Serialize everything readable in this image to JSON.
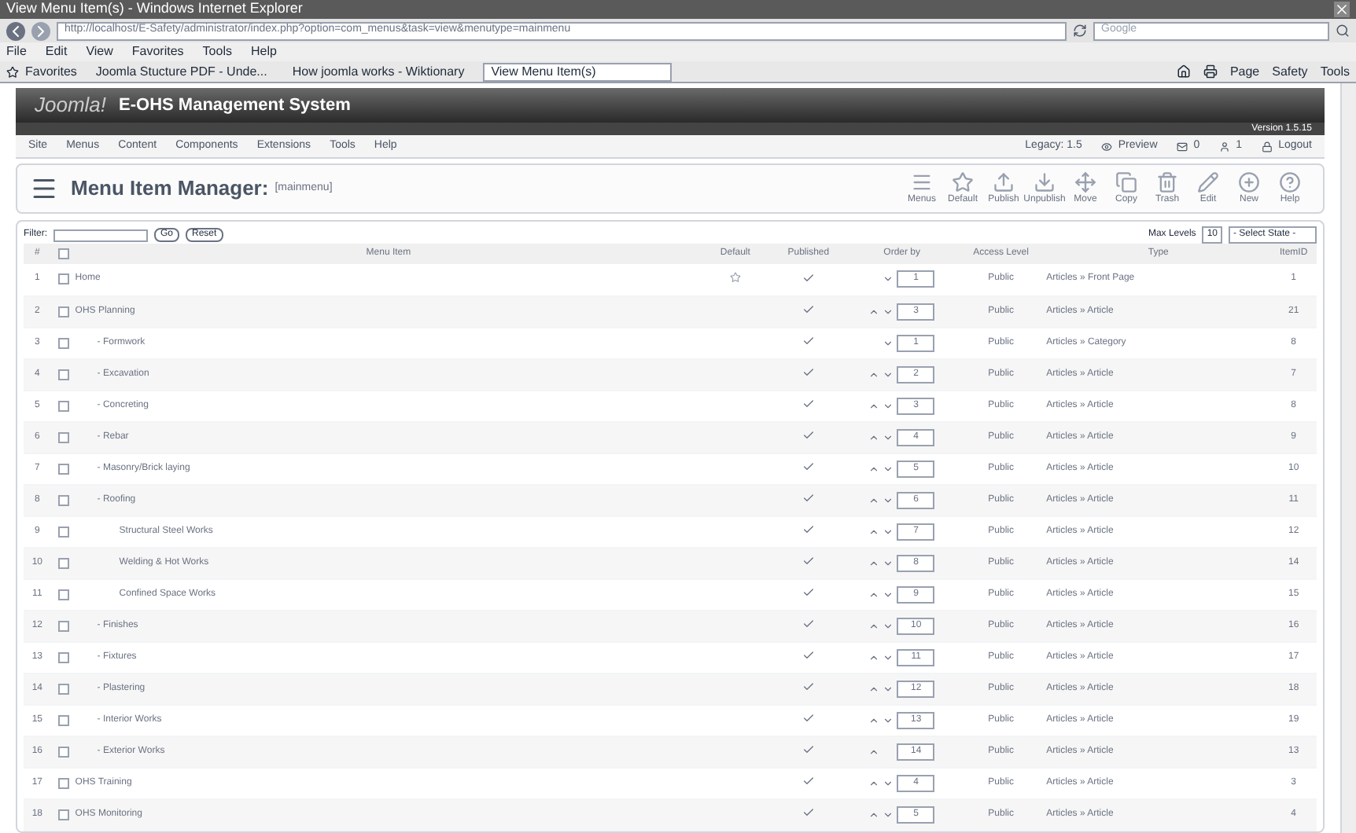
{
  "window": {
    "title": "View Menu Item(s) - Windows Internet Explorer"
  },
  "address_bar": {
    "url": "http://localhost/E-Safety/administrator/index.php?option=com_menus&task=view&menutype=mainmenu",
    "search_placeholder": "Google"
  },
  "browser_menu": [
    "File",
    "Edit",
    "View",
    "Favorites",
    "Tools",
    "Help"
  ],
  "favorites_bar": {
    "label": "Favorites",
    "tabs": [
      {
        "label": "Joomla Stucture PDF - Unde...",
        "selected": false
      },
      {
        "label": "How joomla works - Wiktionary",
        "selected": false
      },
      {
        "label": "View Menu Item(s)",
        "selected": true
      }
    ],
    "commands": [
      "Page",
      "Safety",
      "Tools"
    ]
  },
  "header": {
    "logo": "Joomla!",
    "title": "E-OHS Management System",
    "version": "Version 1.5.15"
  },
  "admin_menu": [
    "Site",
    "Menus",
    "Content",
    "Components",
    "Extensions",
    "Tools",
    "Help"
  ],
  "status": {
    "legacy": "Legacy: 1.5",
    "preview": "Preview",
    "messages": "0",
    "users": "1",
    "logout": "Logout"
  },
  "page_title": {
    "title": "Menu Item Manager:",
    "subtitle": "[mainmenu]"
  },
  "toolbar": [
    "Menus",
    "Default",
    "Publish",
    "Unpublish",
    "Move",
    "Copy",
    "Trash",
    "Edit",
    "New",
    "Help"
  ],
  "filter": {
    "label": "Filter:",
    "go": "Go",
    "reset": "Reset",
    "max_levels_label": "Max Levels",
    "max_levels": "10",
    "state": "- Select State -"
  },
  "table": {
    "columns": [
      "#",
      "Menu Item",
      "Default",
      "Published",
      "Order by",
      "Access Level",
      "Type",
      "ItemID"
    ],
    "select_all_checked": false,
    "rows": [
      {
        "num": "1",
        "title": "Home",
        "checked": false,
        "default": true,
        "published": true,
        "up": false,
        "down": true,
        "order": "1",
        "access": "Public",
        "type": "Articles » Front Page",
        "itemid": "1"
      },
      {
        "num": "2",
        "title": "OHS Planning",
        "checked": false,
        "default": false,
        "published": true,
        "up": true,
        "down": true,
        "order": "3",
        "access": "Public",
        "type": "Articles » Article",
        "itemid": "21",
        "children": [
          {
            "num": "3",
            "title": "- Formwork",
            "checked": false,
            "default": false,
            "published": true,
            "up": false,
            "down": true,
            "order": "1",
            "access": "Public",
            "type": "Articles » Category",
            "itemid": "8"
          },
          {
            "num": "4",
            "title": "- Excavation",
            "checked": false,
            "default": false,
            "published": true,
            "up": true,
            "down": true,
            "order": "2",
            "access": "Public",
            "type": "Articles » Article",
            "itemid": "7"
          },
          {
            "num": "5",
            "title": "- Concreting",
            "checked": false,
            "default": false,
            "published": true,
            "up": true,
            "down": true,
            "order": "3",
            "access": "Public",
            "type": "Articles » Article",
            "itemid": "8"
          },
          {
            "num": "6",
            "title": "- Rebar",
            "checked": false,
            "default": false,
            "published": true,
            "up": true,
            "down": true,
            "order": "4",
            "access": "Public",
            "type": "Articles » Article",
            "itemid": "9"
          },
          {
            "num": "7",
            "title": "- Masonry/Brick laying",
            "checked": false,
            "default": false,
            "published": true,
            "up": true,
            "down": true,
            "order": "5",
            "access": "Public",
            "type": "Articles » Article",
            "itemid": "10"
          },
          {
            "num": "8",
            "title": "- Roofing",
            "checked": false,
            "default": false,
            "published": true,
            "up": true,
            "down": true,
            "order": "6",
            "access": "Public",
            "type": "Articles » Article",
            "itemid": "11",
            "children": [
              {
                "num": "9",
                "title": "Structural Steel Works",
                "checked": false,
                "default": false,
                "published": true,
                "up": true,
                "down": true,
                "order": "7",
                "access": "Public",
                "type": "Articles » Article",
                "itemid": "12"
              },
              {
                "num": "10",
                "title": "Welding & Hot Works",
                "checked": false,
                "default": false,
                "published": true,
                "up": true,
                "down": true,
                "order": "8",
                "access": "Public",
                "type": "Articles » Article",
                "itemid": "14"
              },
              {
                "num": "11",
                "title": "Confined Space Works",
                "checked": false,
                "default": false,
                "published": true,
                "up": true,
                "down": true,
                "order": "9",
                "access": "Public",
                "type": "Articles » Article",
                "itemid": "15"
              }
            ]
          },
          {
            "num": "12",
            "title": "- Finishes",
            "checked": false,
            "default": false,
            "published": true,
            "up": true,
            "down": true,
            "order": "10",
            "access": "Public",
            "type": "Articles » Article",
            "itemid": "16"
          },
          {
            "num": "13",
            "title": "- Fixtures",
            "checked": false,
            "default": false,
            "published": true,
            "up": true,
            "down": true,
            "order": "11",
            "access": "Public",
            "type": "Articles » Article",
            "itemid": "17"
          },
          {
            "num": "14",
            "title": "- Plastering",
            "checked": false,
            "default": false,
            "published": true,
            "up": true,
            "down": true,
            "order": "12",
            "access": "Public",
            "type": "Articles » Article",
            "itemid": "18"
          },
          {
            "num": "15",
            "title": "- Interior Works",
            "checked": false,
            "default": false,
            "published": true,
            "up": true,
            "down": true,
            "order": "13",
            "access": "Public",
            "type": "Articles » Article",
            "itemid": "19"
          },
          {
            "num": "16",
            "title": "- Exterior Works",
            "checked": false,
            "default": false,
            "published": true,
            "up": true,
            "down": false,
            "order": "14",
            "access": "Public",
            "type": "Articles » Article",
            "itemid": "13"
          }
        ]
      },
      {
        "num": "17",
        "title": "OHS Training",
        "checked": false,
        "default": false,
        "published": true,
        "up": true,
        "down": true,
        "order": "4",
        "access": "Public",
        "type": "Articles » Article",
        "itemid": "3"
      },
      {
        "num": "18",
        "title": "OHS Monitoring",
        "checked": false,
        "default": false,
        "published": true,
        "up": true,
        "down": true,
        "order": "5",
        "access": "Public",
        "type": "Articles » Article",
        "itemid": "4"
      }
    ]
  }
}
